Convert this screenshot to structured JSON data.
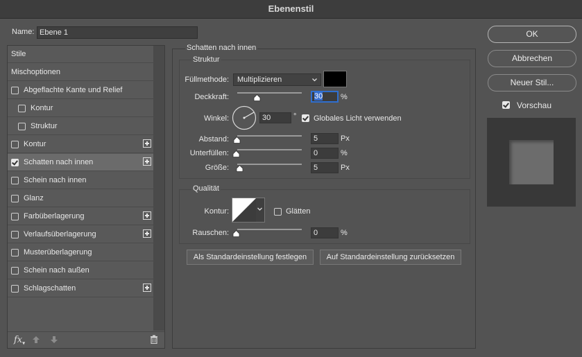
{
  "window": {
    "title": "Ebenenstil"
  },
  "name_row": {
    "label": "Name:",
    "value": "Ebene 1"
  },
  "styles_list": {
    "items": [
      {
        "label": "Stile",
        "checkbox": false,
        "checked": false,
        "plus": false,
        "indent": 0,
        "selected": false
      },
      {
        "label": "Mischoptionen",
        "checkbox": false,
        "checked": false,
        "plus": false,
        "indent": 0,
        "selected": false
      },
      {
        "label": "Abgeflachte Kante und Relief",
        "checkbox": true,
        "checked": false,
        "plus": false,
        "indent": 0,
        "selected": false
      },
      {
        "label": "Kontur",
        "checkbox": true,
        "checked": false,
        "plus": false,
        "indent": 1,
        "selected": false
      },
      {
        "label": "Struktur",
        "checkbox": true,
        "checked": false,
        "plus": false,
        "indent": 1,
        "selected": false
      },
      {
        "label": "Kontur",
        "checkbox": true,
        "checked": false,
        "plus": true,
        "indent": 0,
        "selected": false
      },
      {
        "label": "Schatten nach innen",
        "checkbox": true,
        "checked": true,
        "plus": true,
        "indent": 0,
        "selected": true
      },
      {
        "label": "Schein nach innen",
        "checkbox": true,
        "checked": false,
        "plus": false,
        "indent": 0,
        "selected": false
      },
      {
        "label": "Glanz",
        "checkbox": true,
        "checked": false,
        "plus": false,
        "indent": 0,
        "selected": false
      },
      {
        "label": "Farbüberlagerung",
        "checkbox": true,
        "checked": false,
        "plus": true,
        "indent": 0,
        "selected": false
      },
      {
        "label": "Verlaufsüberlagerung",
        "checkbox": true,
        "checked": false,
        "plus": true,
        "indent": 0,
        "selected": false
      },
      {
        "label": "Musterüberlagerung",
        "checkbox": true,
        "checked": false,
        "plus": false,
        "indent": 0,
        "selected": false
      },
      {
        "label": "Schein nach außen",
        "checkbox": true,
        "checked": false,
        "plus": false,
        "indent": 0,
        "selected": false
      },
      {
        "label": "Schlagschatten",
        "checkbox": true,
        "checked": false,
        "plus": true,
        "indent": 0,
        "selected": false
      }
    ],
    "footer": {
      "fx_label": "fx",
      "icons": [
        "fx-icon",
        "arrow-up-icon",
        "arrow-down-icon",
        "trash-icon"
      ]
    }
  },
  "section": {
    "title": "Schatten nach innen",
    "structure": {
      "title": "Struktur",
      "blend_mode_label": "Füllmethode:",
      "blend_mode_value": "Multiplizieren",
      "shadow_color": "#000000",
      "opacity_label": "Deckkraft:",
      "opacity_value": "30",
      "opacity_unit": "%",
      "opacity_level": 0.3,
      "angle_label": "Winkel:",
      "angle_value": "30",
      "angle_unit": "°",
      "global_light_label": "Globales Licht verwenden",
      "global_light_checked": true,
      "distance_label": "Abstand:",
      "distance_value": "5",
      "distance_unit": "Px",
      "choke_label": "Unterfüllen:",
      "choke_value": "0",
      "choke_unit": "%",
      "size_label": "Größe:",
      "size_value": "5",
      "size_unit": "Px"
    },
    "quality": {
      "title": "Qualität",
      "contour_label": "Kontur:",
      "antialias_label": "Glätten",
      "antialias_checked": false,
      "noise_label": "Rauschen:",
      "noise_value": "0",
      "noise_unit": "%"
    },
    "buttons": {
      "make_default": "Als Standardeinstellung festlegen",
      "reset_default": "Auf Standardeinstellung zurücksetzen"
    }
  },
  "actions": {
    "ok": "OK",
    "cancel": "Abbrechen",
    "new_style": "Neuer Stil...",
    "preview_label": "Vorschau",
    "preview_checked": true
  }
}
